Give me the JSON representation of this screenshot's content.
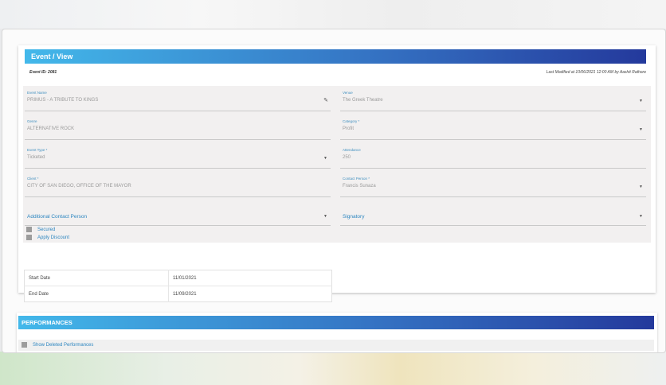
{
  "event_section": {
    "title": "Event / View",
    "event_id": "Event ID: 2081",
    "last_modified": "Last Modified at 10/06/2021 12:00 AM by Aashit Rathore"
  },
  "fields": {
    "event_name": {
      "label": "Event Name",
      "value": "PRIMUS - A TRIBUTE TO KINGS"
    },
    "venue": {
      "label": "Venue",
      "value": "The Greek Theatre"
    },
    "genre": {
      "label": "Genre",
      "value": "ALTERNATIVE ROCK"
    },
    "category": {
      "label": "Category *",
      "value": "Profit"
    },
    "event_type": {
      "label": "Event Type *",
      "value": "Ticketed"
    },
    "attendance": {
      "label": "Attendance",
      "value": "250"
    },
    "client": {
      "label": "Client *",
      "value": "CITY OF SAN DIEGO, OFFICE OF THE MAYOR"
    },
    "contact_person": {
      "label": "Contact Person *",
      "value": "Francis Sunaza"
    },
    "additional_contact": {
      "label": "Additional Contact Person"
    },
    "signatory": {
      "label": "Signatory"
    }
  },
  "checkboxes": {
    "secured": "Secured",
    "apply_discount": "Apply Discount"
  },
  "dates": [
    {
      "label": "Start Date",
      "value": "11/01/2021"
    },
    {
      "label": "End Date",
      "value": "11/09/2021"
    }
  ],
  "performances": {
    "title": "PERFORMANCES",
    "show_deleted": "Show Deleted Performances"
  },
  "colors": {
    "banner_start": "#43b8ea",
    "banner_end": "#24399c",
    "label_blue": "#3f8fbf"
  },
  "icons": {
    "edit": "✎",
    "dropdown": "▼"
  }
}
